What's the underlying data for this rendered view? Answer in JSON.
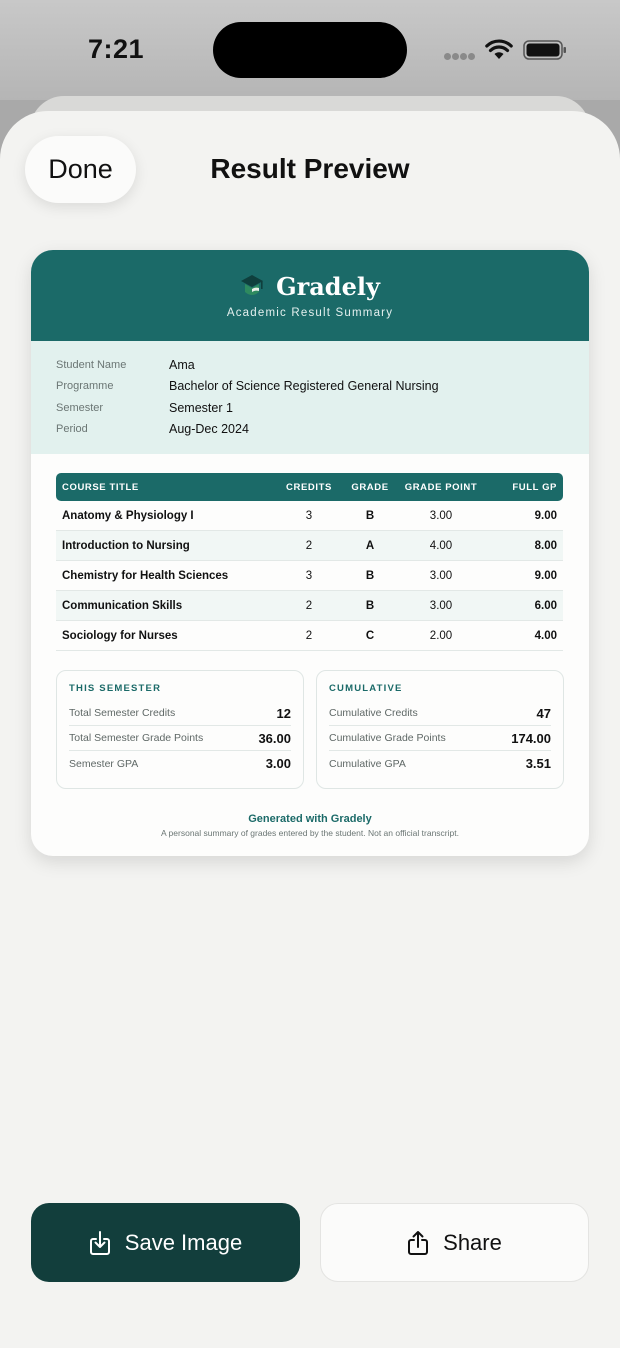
{
  "status_bar": {
    "time": "7:21"
  },
  "sheet": {
    "done_label": "Done",
    "title": "Result Preview"
  },
  "card": {
    "brand": "Gradely",
    "tagline": "Academic Result Summary",
    "info": [
      {
        "label": "Student Name",
        "value": "Ama"
      },
      {
        "label": "Programme",
        "value": "Bachelor of Science Registered General Nursing"
      },
      {
        "label": "Semester",
        "value": "Semester 1"
      },
      {
        "label": "Period",
        "value": "Aug-Dec 2024"
      }
    ],
    "table": {
      "headers": {
        "course": "COURSE TITLE",
        "credits": "CREDITS",
        "grade": "GRADE",
        "grade_point": "GRADE POINT",
        "full_gp": "FULL GP"
      },
      "rows": [
        {
          "course": "Anatomy & Physiology I",
          "credits": "3",
          "grade": "B",
          "grade_point": "3.00",
          "full_gp": "9.00"
        },
        {
          "course": "Introduction to Nursing",
          "credits": "2",
          "grade": "A",
          "grade_point": "4.00",
          "full_gp": "8.00"
        },
        {
          "course": "Chemistry for Health Sciences",
          "credits": "3",
          "grade": "B",
          "grade_point": "3.00",
          "full_gp": "9.00"
        },
        {
          "course": "Communication Skills",
          "credits": "2",
          "grade": "B",
          "grade_point": "3.00",
          "full_gp": "6.00"
        },
        {
          "course": "Sociology for Nurses",
          "credits": "2",
          "grade": "C",
          "grade_point": "2.00",
          "full_gp": "4.00"
        }
      ]
    },
    "this_semester": {
      "heading": "THIS SEMESTER",
      "rows": [
        {
          "label": "Total Semester Credits",
          "value": "12"
        },
        {
          "label": "Total Semester Grade Points",
          "value": "36.00"
        },
        {
          "label": "Semester GPA",
          "value": "3.00"
        }
      ]
    },
    "cumulative": {
      "heading": "CUMULATIVE",
      "rows": [
        {
          "label": "Cumulative Credits",
          "value": "47"
        },
        {
          "label": "Cumulative Grade Points",
          "value": "174.00"
        },
        {
          "label": "Cumulative GPA",
          "value": "3.51"
        }
      ]
    },
    "footer_title": "Generated with Gradely",
    "footer_note": "A personal summary of grades entered by the student. Not an official transcript."
  },
  "actions": {
    "save_label": "Save Image",
    "share_label": "Share"
  },
  "colors": {
    "primary": "#1b6a68",
    "dark": "#123e3c",
    "info_bg": "#e2f1ee",
    "sheet_bg": "#f3f3f1"
  },
  "icons": {
    "logo": "graduation-cap-icon",
    "save": "download-tray-icon",
    "share": "share-icon"
  }
}
